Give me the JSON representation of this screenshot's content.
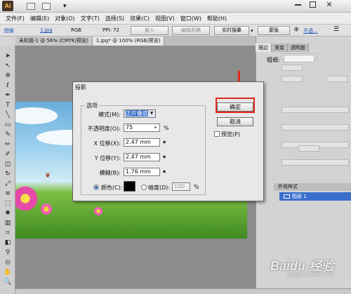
{
  "window": {
    "app_logo": "Ai",
    "close_glyph": "✕"
  },
  "menubar": [
    "文件(F)",
    "编辑(E)",
    "对象(O)",
    "文字(T)",
    "选择(S)",
    "效果(C)",
    "视图(V)",
    "窗口(W)",
    "帮助(H)"
  ],
  "control_bar": {
    "object_type": "图像",
    "file_name": "1.jpg",
    "color_mode": "RGB",
    "ppi": "PPI: 72",
    "embed_button": "嵌入",
    "edit_original_button": "编辑原稿",
    "live_trace_button": "实时描摹",
    "mask_button": "蒙版",
    "opacity_label": "不透..."
  },
  "doc_tabs": [
    "未标题-1 @ 56% (CMYK/预览)",
    "1.jpg* @ 100% (RGB/预览)"
  ],
  "right_panel": {
    "tabs": [
      "描边",
      "渐变",
      "透明度"
    ],
    "stroke_weight_label": "粗细:",
    "layers_header": "外观样式",
    "layer_name": "图层 1"
  },
  "dialog": {
    "title": "投影",
    "group_title": "选项",
    "mode_label": "模式(M):",
    "mode_value": "正片叠底",
    "opacity_label": "不透明度(O):",
    "opacity_value": "75",
    "opacity_unit": "%",
    "x_offset_label": "X 位移(X):",
    "x_offset_value": "2.47 mm",
    "y_offset_label": "Y 位移(Y):",
    "y_offset_value": "2.47 mm",
    "blur_label": "模糊(B):",
    "blur_value": "1.76 mm",
    "color_label": "颜色(C):",
    "darkness_label": "暗度(D):",
    "darkness_value": "100",
    "darkness_unit": "%",
    "ok_button": "确定",
    "cancel_button": "取消",
    "preview_label": "预览(P)",
    "shadow_color": "#000000",
    "highlight_color": "#e2261c"
  },
  "watermark": {
    "brand": "Baidu 经验",
    "url": "jingyan.baidu.com"
  }
}
